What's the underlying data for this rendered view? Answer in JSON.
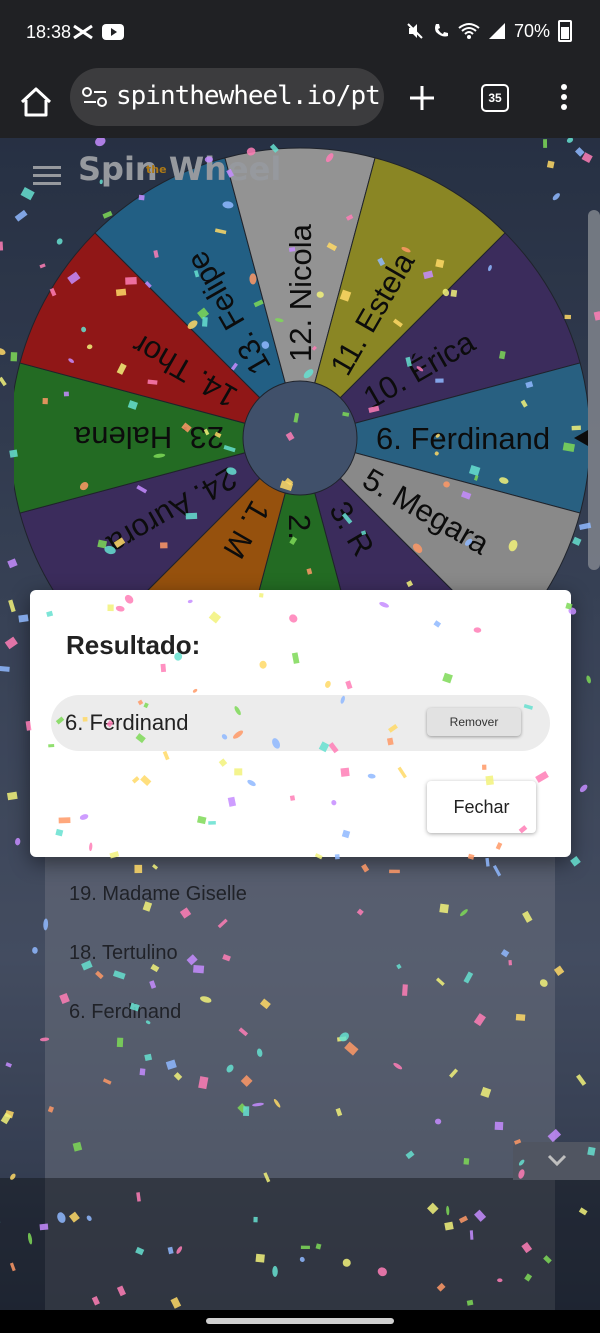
{
  "status": {
    "time": "18:38",
    "battery": "70%"
  },
  "browser": {
    "url": "spinthewheel.io/pt",
    "tab_count": "35"
  },
  "app": {
    "logo_text": "Spin Wheel",
    "logo_small": "the"
  },
  "wheel": {
    "segments": [
      {
        "label": "13. Felipe",
        "color": "#2e7fb0"
      },
      {
        "label": "12. Nicola",
        "color": "#c4c4c4"
      },
      {
        "label": "11. Estela",
        "color": "#b9b331"
      },
      {
        "label": "10. Érica",
        "color": "#4f3b7b"
      },
      {
        "label": "6. Ferdinand",
        "color": "#3680ad"
      },
      {
        "label": "5. Megara",
        "color": "#b7b7b7"
      },
      {
        "label": "3. R",
        "color": "#4f3b7b"
      },
      {
        "label": "2.",
        "color": "#2f8f2f"
      },
      {
        "label": "1. M",
        "color": "#c86d12"
      },
      {
        "label": "24. Aurora",
        "color": "#4f3b7b"
      },
      {
        "label": "23. Halena",
        "color": "#2f8f2f"
      },
      {
        "label": "14. Thor",
        "color": "#c11f1f"
      }
    ]
  },
  "list": {
    "items": [
      "19. Madame Giselle",
      "18. Tertulino",
      "6. Ferdinand"
    ]
  },
  "dialog": {
    "title": "Resultado:",
    "result": "6. Ferdinand",
    "remove_label": "Remover",
    "close_label": "Fechar"
  }
}
